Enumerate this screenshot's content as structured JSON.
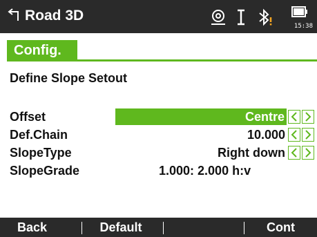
{
  "titlebar": {
    "title": "Road 3D",
    "clock": "15:38"
  },
  "icons": [
    "back-arrow-icon",
    "target-icon",
    "text-cursor-icon",
    "bluetooth-warning-icon",
    "battery-icon"
  ],
  "tab": {
    "label": "Config."
  },
  "subtitle": "Define Slope Setout",
  "fields": [
    {
      "label": "Offset",
      "value": "Centre"
    },
    {
      "label": "Def.Chain",
      "value": "10.000"
    },
    {
      "label": "SlopeType",
      "value": "Right down"
    },
    {
      "label": "SlopeGrade",
      "value": "1.000:  2.000 h:v"
    }
  ],
  "softkeys": [
    "Back",
    "Default",
    "",
    "",
    "Cont"
  ],
  "colors": {
    "accent": "#5fb81e",
    "bar": "#2a2a2a",
    "warning": "#f5a623"
  }
}
